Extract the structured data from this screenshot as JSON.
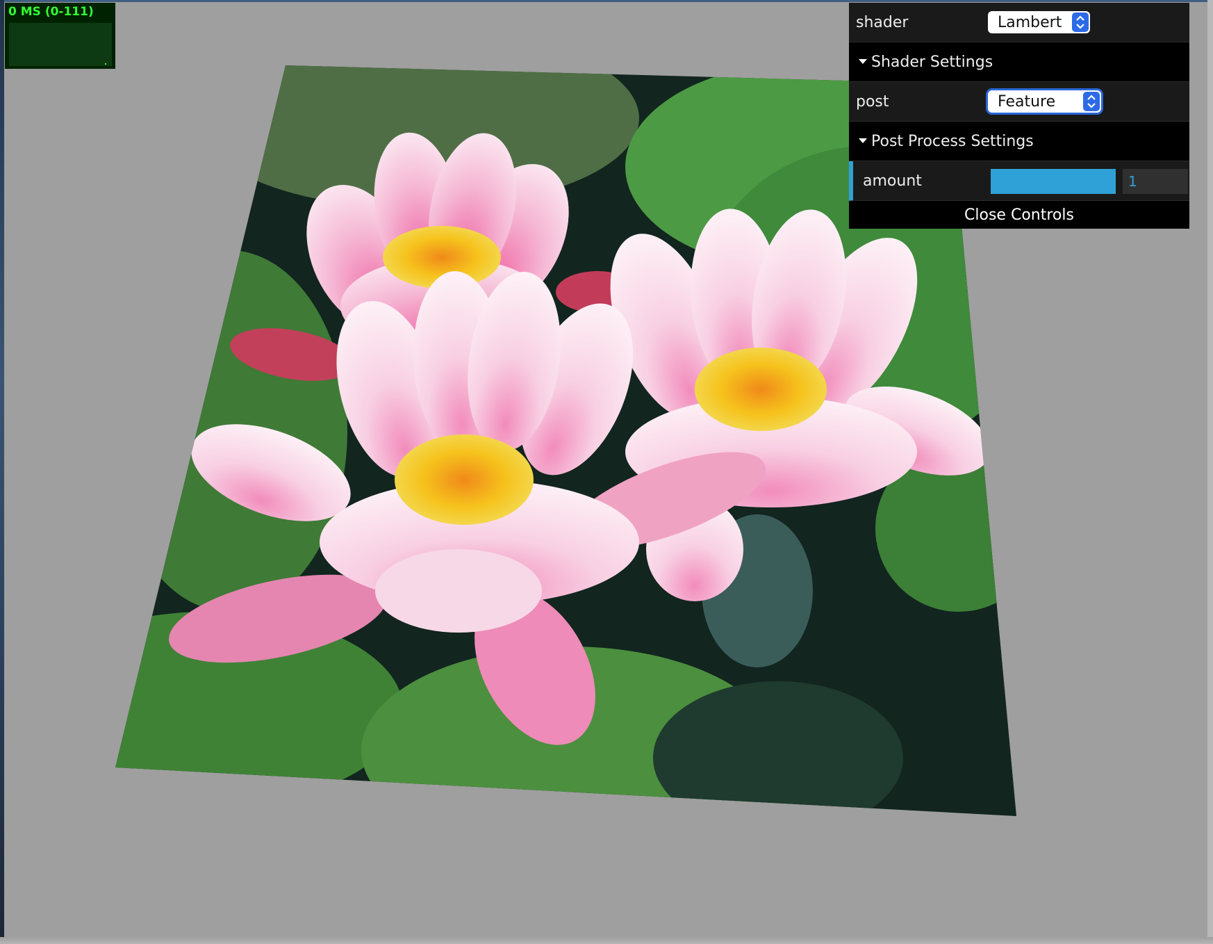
{
  "stats": {
    "label": "0 MS (0-111)"
  },
  "gui": {
    "shader": {
      "label": "shader",
      "value": "Lambert"
    },
    "shader_folder": {
      "label": "Shader Settings"
    },
    "post": {
      "label": "post",
      "value": "Feature"
    },
    "post_folder": {
      "label": "Post Process Settings"
    },
    "amount": {
      "label": "amount",
      "value": "1",
      "fill_fraction": 1.0
    },
    "close_label": "Close Controls"
  },
  "scene": {
    "background": "#9f9f9f",
    "subject": "textured plane (pink water lilies on lily pads)",
    "accent": "#2fa1d6"
  }
}
